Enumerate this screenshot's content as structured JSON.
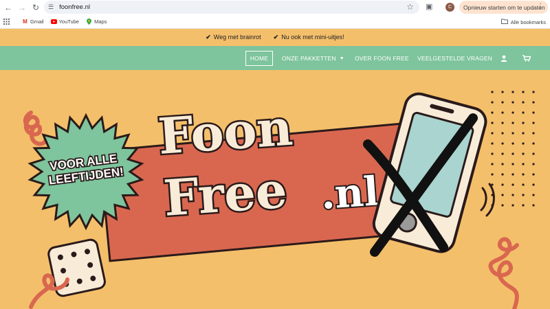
{
  "browser": {
    "url": "foonfree.nl",
    "update_button": "Opnieuw starten om te updaten",
    "avatar_letter": "C",
    "bookmarks": [
      {
        "label": "Gmail"
      },
      {
        "label": "YouTube"
      },
      {
        "label": "Maps"
      }
    ],
    "all_bookmarks": "Alle bookmarks"
  },
  "promo": {
    "items": [
      "Weg met brainrot",
      "Nu ook met mini-uitjes!"
    ]
  },
  "nav": {
    "home": "HOME",
    "packages": "ONZE PAKKETTEN",
    "about": "OVER FOON FREE",
    "faq": "VEELGESTELDE VRAGEN"
  },
  "hero": {
    "badge_line1": "VOOR ALLE",
    "badge_line2": "LEEFTIJDEN!",
    "logo_line1": "Foon",
    "logo_line2": "Free",
    "logo_domain": ".nl"
  },
  "colors": {
    "background": "#f4bf6b",
    "nav_green": "#7ec49c",
    "banner_red": "#d9674f",
    "badge_green": "#7ec49c",
    "logo_fill": "#f8ecd8",
    "outline": "#2a1a1a"
  }
}
